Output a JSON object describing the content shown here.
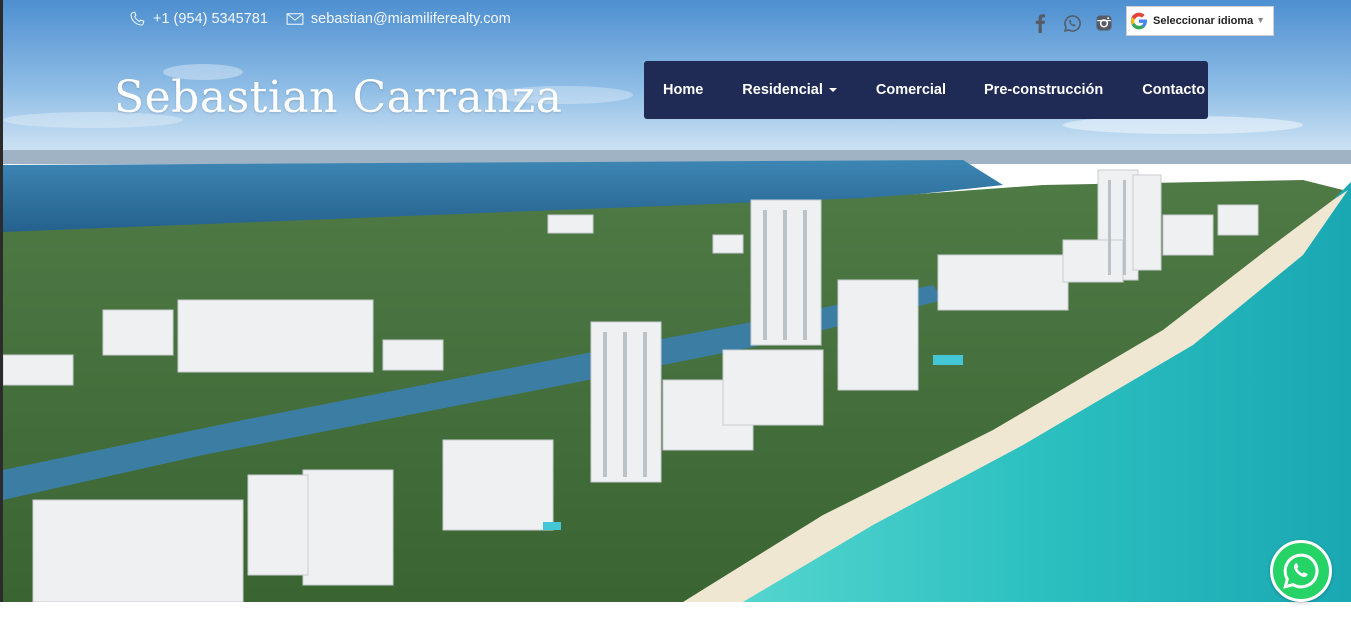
{
  "header": {
    "phone": "+1 (954) 5345781",
    "email": "sebastian@miamiliferealty.com",
    "brand": "Sebastian Carranza",
    "social": [
      {
        "icon": "facebook-icon"
      },
      {
        "icon": "whatsapp-icon"
      },
      {
        "icon": "instagram-icon"
      }
    ],
    "language": {
      "label": "Seleccionar idioma",
      "icon": "google-g-icon"
    }
  },
  "nav": {
    "items": [
      {
        "label": "Home"
      },
      {
        "label": "Residencial",
        "dropdown": true
      },
      {
        "label": "Comercial"
      },
      {
        "label": "Pre-construcción"
      },
      {
        "label": "Contacto"
      }
    ]
  },
  "floating": {
    "whatsapp_icon": "whatsapp-float-icon"
  },
  "colors": {
    "nav_bg": "#1f2b55",
    "ocean": "#2fc3c2",
    "bay": "#2d6f9c",
    "whatsapp": "#25d366"
  }
}
